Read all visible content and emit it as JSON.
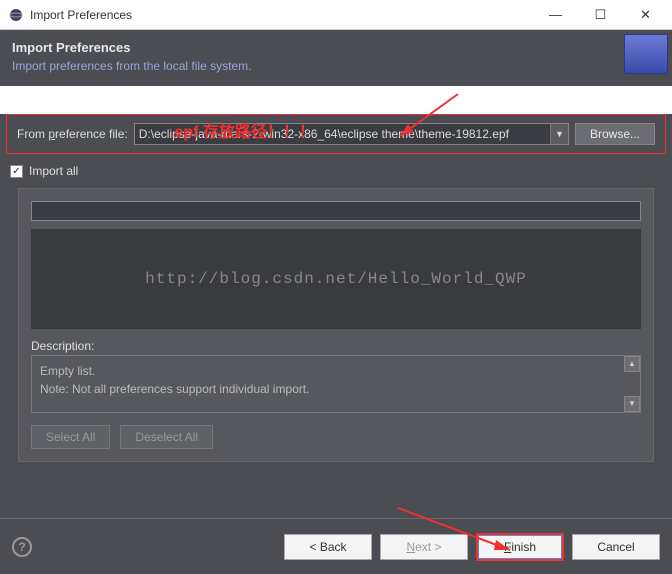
{
  "window": {
    "title": "Import Preferences",
    "minimize": "—",
    "maximize": "☐",
    "close": "✕"
  },
  "header": {
    "title": "Import Preferences",
    "subtitle": "Import preferences from the local file system."
  },
  "annotation": {
    "text": ".epf 存放路径！！！"
  },
  "file": {
    "label_pre": "From ",
    "label_underline": "p",
    "label_post": "reference file:",
    "value": "D:\\eclipse-java-mars-2-win32-x86_64\\eclipse theme\\theme-19812.epf",
    "browse": "Browse..."
  },
  "import_all": {
    "checked": "✓",
    "label": "Import all"
  },
  "panel": {
    "watermark": "http://blog.csdn.net/Hello_World_QWP",
    "desc_label": "Description:",
    "desc_line1": "Empty list.",
    "desc_line2": "Note: Not all preferences support individual import.",
    "select_all": "Select All",
    "deselect_all": "Deselect All"
  },
  "footer": {
    "back": "<  Back",
    "next_pre": "N",
    "next_post": "ext  >",
    "finish_pre": "F",
    "finish_post": "inish",
    "cancel": "Cancel",
    "help": "?"
  }
}
